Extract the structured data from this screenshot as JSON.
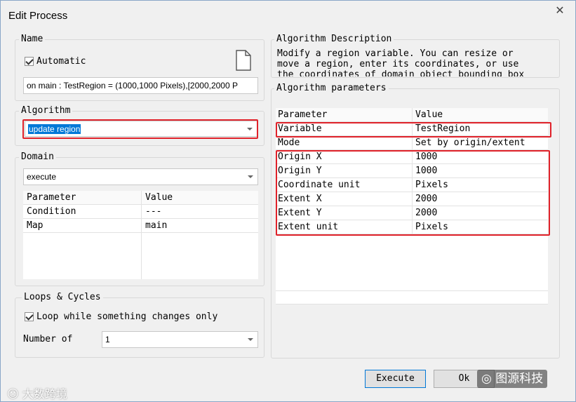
{
  "window": {
    "title": "Edit Process",
    "close_glyph": "✕"
  },
  "name_group": {
    "legend": "Name",
    "automatic_label": "Automatic",
    "automatic_checked": true,
    "description_value": "on main : TestRegion = (1000,1000 Pixels),[2000,2000 P"
  },
  "algorithm_group": {
    "legend": "Algorithm",
    "selected": "update region"
  },
  "domain_group": {
    "legend": "Domain",
    "selected": "execute",
    "table": {
      "headers": [
        "Parameter",
        "Value"
      ],
      "rows": [
        [
          "Condition",
          "---"
        ],
        [
          "Map",
          "main"
        ]
      ]
    }
  },
  "loops_group": {
    "legend": "Loops & Cycles",
    "loop_label": "Loop while something changes only",
    "loop_checked": true,
    "number_of_label": "Number of",
    "number_of_value": "1"
  },
  "algorithm_description": {
    "legend": "Algorithm Description",
    "lines": [
      "Modify a region variable. You can resize or",
      "move a region, enter its coordinates, or use",
      "the coordinates of domain object bounding box"
    ]
  },
  "algorithm_parameters": {
    "legend": "Algorithm parameters",
    "headers": [
      "Parameter",
      "Value"
    ],
    "rows": [
      [
        "Variable",
        "TestRegion"
      ],
      [
        "Mode",
        "Set by origin/extent"
      ],
      [
        "Origin X",
        "1000"
      ],
      [
        "Origin Y",
        "1000"
      ],
      [
        "Coordinate unit",
        "Pixels"
      ],
      [
        "Extent X",
        "2000"
      ],
      [
        "Extent Y",
        "2000"
      ],
      [
        "Extent unit",
        "Pixels"
      ]
    ]
  },
  "buttons": {
    "execute": "Execute",
    "ok": "Ok"
  },
  "watermarks": {
    "left": "大数跨境",
    "right": "图源科技"
  },
  "colors": {
    "highlight": "#e0222a",
    "selection": "#0078d7"
  }
}
